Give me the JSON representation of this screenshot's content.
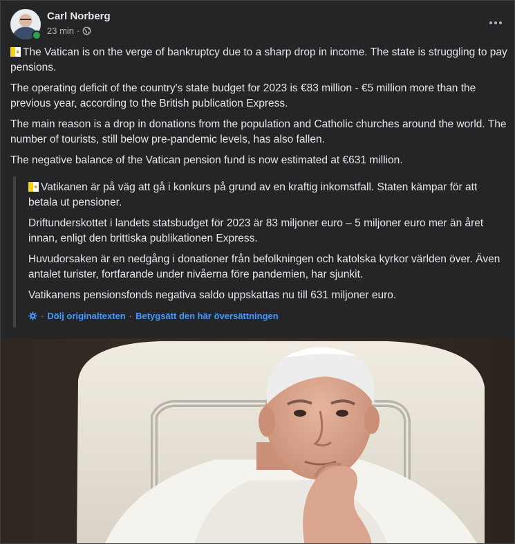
{
  "post": {
    "author": "Carl Norberg",
    "time": "23 min",
    "separator": "·",
    "privacy_icon": "globe-icon",
    "more_icon": "more-horizontal-icon",
    "flag_icon": "vatican-flag-emoji",
    "paragraphs": [
      "The Vatican is on the verge of bankruptcy due to a sharp drop in income. The state is struggling to pay pensions.",
      "The operating deficit of the country's state budget for 2023 is €83 million - €5 million more than the previous year, according to the British publication Express.",
      "The main reason is a drop in donations from the population and Catholic churches around the world. The number of tourists, still below pre-pandemic levels, has also fallen.",
      "The negative balance of the Vatican pension fund is now estimated at €631 million."
    ]
  },
  "original": {
    "paragraphs": [
      "Vatikanen är på väg att gå i konkurs på grund av en kraftig inkomstfall. Staten kämpar för att betala ut pensioner.",
      "Driftunderskottet i landets statsbudget för 2023 är 83 miljoner euro – 5 miljoner euro mer än året innan, enligt den brittiska publikationen Express.",
      "Huvudorsaken är en nedgång i donationer från befolkningen och katolska kyrkor världen över. Även antalet turister, fortfarande under nivåerna före pandemien, har sjunkit.",
      "Vatikanens pensionsfonds negativa saldo uppskattas nu till 631 miljoner euro."
    ],
    "settings_icon": "gear-icon",
    "separator": "·",
    "hide_original_label": "Dölj originaltexten",
    "rate_translation_label": "Betygsätt den här översättningen"
  },
  "photo": {
    "subject": "pope-photo"
  },
  "colors": {
    "background": "#242526",
    "text": "#e4e6eb",
    "secondary_text": "#b0b3b8",
    "link": "#4599ff",
    "online": "#31a24c"
  }
}
